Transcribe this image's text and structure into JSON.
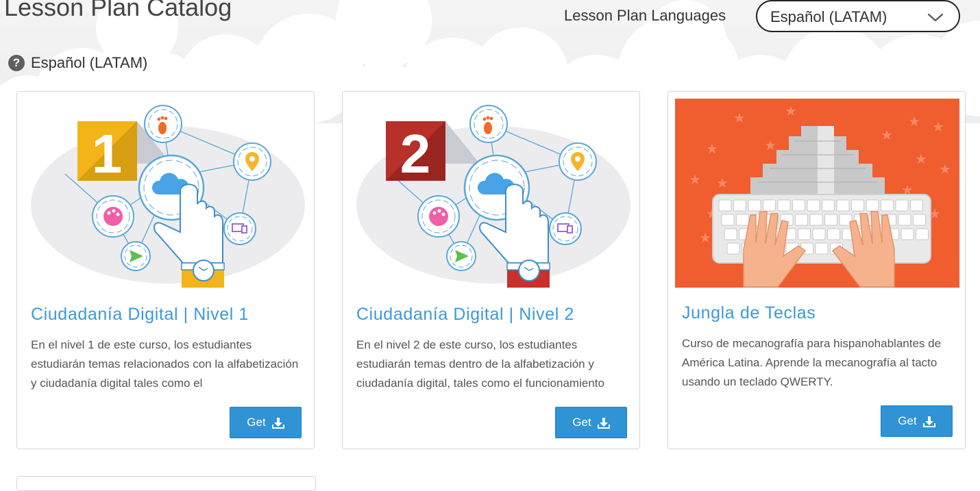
{
  "header": {
    "title": "Lesson Plan Catalog",
    "language_label": "Lesson Plan Languages",
    "language_selected": "Español (LATAM)"
  },
  "section": {
    "title": "Español (LATAM)"
  },
  "cards": [
    {
      "title": "Ciudadanía Digital | Nivel 1",
      "badge": "1",
      "description": "En el nivel 1 de este curso, los estudiantes estudiarán temas relacionados con la alfabetización y ciudadanía digital tales como el",
      "button_label": "Get"
    },
    {
      "title": "Ciudadanía Digital | Nivel 2",
      "badge": "2",
      "description": "En el nivel 2 de este curso, los estudiantes estudiarán temas dentro de la alfabetización y ciudadanía digital, tales como el funcionamiento",
      "button_label": "Get"
    },
    {
      "title": "Jungla de Teclas",
      "description": "Curso de mecanografía para hispanohablantes de América Latina. Aprende la mecanografía al tacto usando un teclado QWERTY.",
      "button_label": "Get"
    }
  ],
  "colors": {
    "accent_blue": "#3a9ad9",
    "button_blue": "#2f93d4",
    "level1_yellow": "#f2b418",
    "level2_red": "#b8302a",
    "jungle_orange": "#f05d2f"
  },
  "icons": [
    "help-icon",
    "chevron-down-icon",
    "download-icon",
    "footprint-icon",
    "location-pin-icon",
    "palette-icon",
    "devices-icon",
    "send-icon",
    "cloud-icon"
  ]
}
